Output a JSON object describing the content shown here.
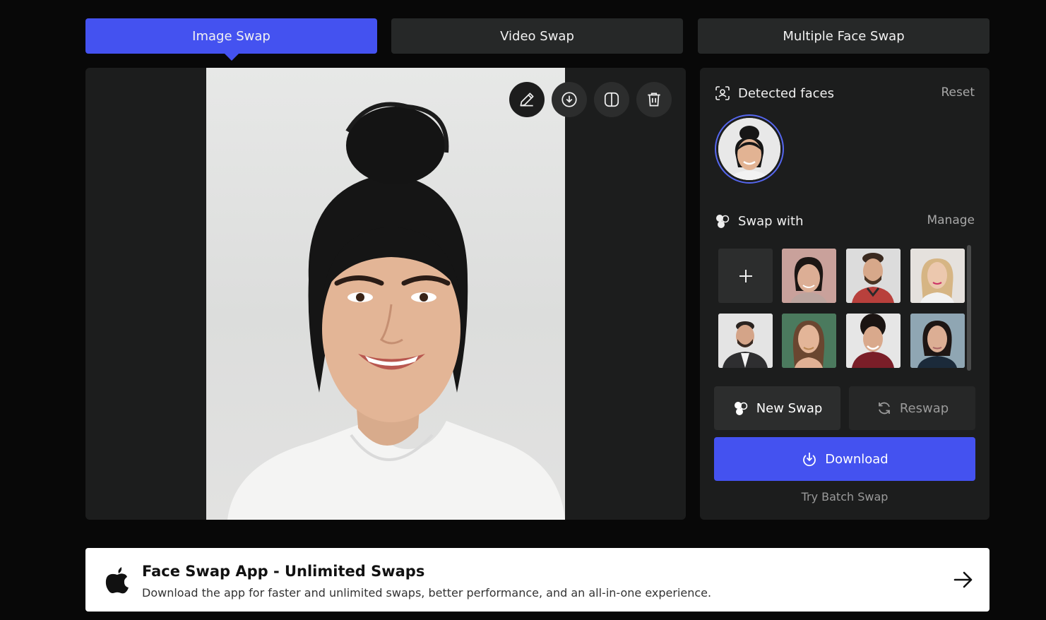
{
  "tabs": [
    {
      "label": "Image Swap",
      "active": true
    },
    {
      "label": "Video Swap",
      "active": false
    },
    {
      "label": "Multiple Face Swap",
      "active": false
    }
  ],
  "toolbar": {
    "icons": [
      "edit-icon",
      "download-icon",
      "compare-icon",
      "trash-icon"
    ]
  },
  "panel": {
    "detected_title": "Detected faces",
    "reset_label": "Reset",
    "swap_title": "Swap with",
    "manage_label": "Manage",
    "add_face_icon": "plus-icon",
    "new_swap_label": "New Swap",
    "reswap_label": "Reswap",
    "download_label": "Download",
    "batch_label": "Try Batch Swap"
  },
  "banner": {
    "title": "Face Swap App - Unlimited Swaps",
    "subtitle": "Download the app for faster and unlimited swaps, better performance, and an all-in-one experience.",
    "icon": "apple-icon",
    "arrow_icon": "arrow-right-icon"
  },
  "colors": {
    "accent": "#4452f0",
    "background": "#080808",
    "panel": "#1c1d1d"
  }
}
